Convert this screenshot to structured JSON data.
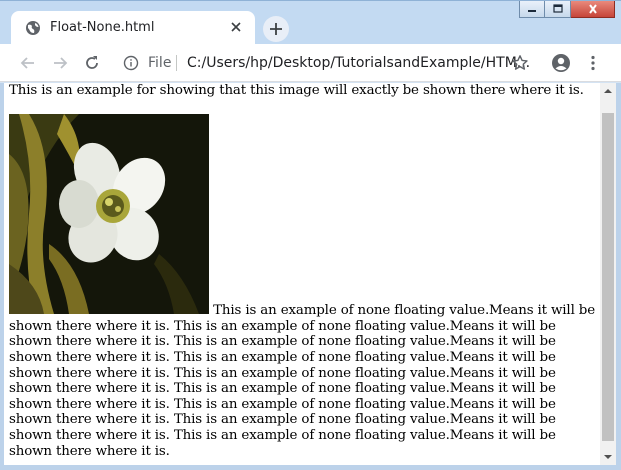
{
  "window": {
    "controls": {
      "minimize": "minimize-icon",
      "maximize": "maximize-icon",
      "close": "close-icon"
    }
  },
  "tab": {
    "title": "Float-None.html",
    "favicon": "globe-icon",
    "close_icon": "close-icon"
  },
  "new_tab_icon": "plus-icon",
  "toolbar": {
    "back_icon": "arrow-left-icon",
    "forward_icon": "arrow-right-icon",
    "reload_icon": "reload-icon",
    "info_icon": "info-icon",
    "scheme_label": "File",
    "url": "C:/Users/hp/Desktop/TutorialsandExample/HTM...",
    "bookmark_icon": "star-icon",
    "profile_icon": "account-icon",
    "menu_icon": "more-vert-icon"
  },
  "page": {
    "lead_text": "This is an example for showing that this image will exactly be shown there where it is.",
    "image": "white flower photo",
    "body_text": "This is an example of none floating value.Means it will be shown there where it is. This is an example of none floating value.Means it will be shown there where it is. This is an example of none floating value.Means it will be shown there where it is. This is an example of none floating value.Means it will be shown there where it is. This is an example of none floating value.Means it will be shown there where it is. This is an example of none floating value.Means it will be shown there where it is. This is an example of none floating value.Means it will be shown there where it is. This is an example of none floating value.Means it will be shown there where it is. This is an example of none floating value.Means it will be shown there where it is."
  },
  "colors": {
    "titlebar": "#c3daf2",
    "toolbar": "#ffffff",
    "scrollbar_thumb": "#c1c1c1"
  }
}
